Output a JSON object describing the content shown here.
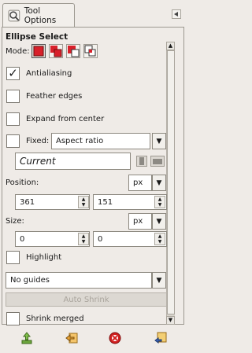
{
  "tab": {
    "label": "Tool Options",
    "icon": "tool-options-icon"
  },
  "panel": {
    "menu_icon": "panel-menu-arrow"
  },
  "title": "Ellipse Select",
  "mode": {
    "label": "Mode:",
    "options": [
      "replace",
      "add",
      "subtract",
      "intersect"
    ],
    "selected": "replace"
  },
  "antialiasing": {
    "label": "Antialiasing",
    "checked": true
  },
  "feather_edges": {
    "label": "Feather edges",
    "checked": false
  },
  "expand_from_center": {
    "label": "Expand from center",
    "checked": false
  },
  "fixed": {
    "label": "Fixed:",
    "checked": false,
    "value": "Aspect ratio"
  },
  "current": {
    "value": "Current"
  },
  "position": {
    "label": "Position:",
    "unit": "px",
    "x": "361",
    "y": "151"
  },
  "size": {
    "label": "Size:",
    "unit": "px",
    "w": "0",
    "h": "0"
  },
  "highlight": {
    "label": "Highlight",
    "checked": false
  },
  "guides": {
    "value": "No guides"
  },
  "auto_shrink": {
    "label": "Auto Shrink"
  },
  "shrink_merged": {
    "label": "Shrink merged",
    "checked": false
  },
  "colors": {
    "select_red": "#d8202a",
    "accent_orange": "#e8a234",
    "reset_red": "#d21f1f"
  }
}
